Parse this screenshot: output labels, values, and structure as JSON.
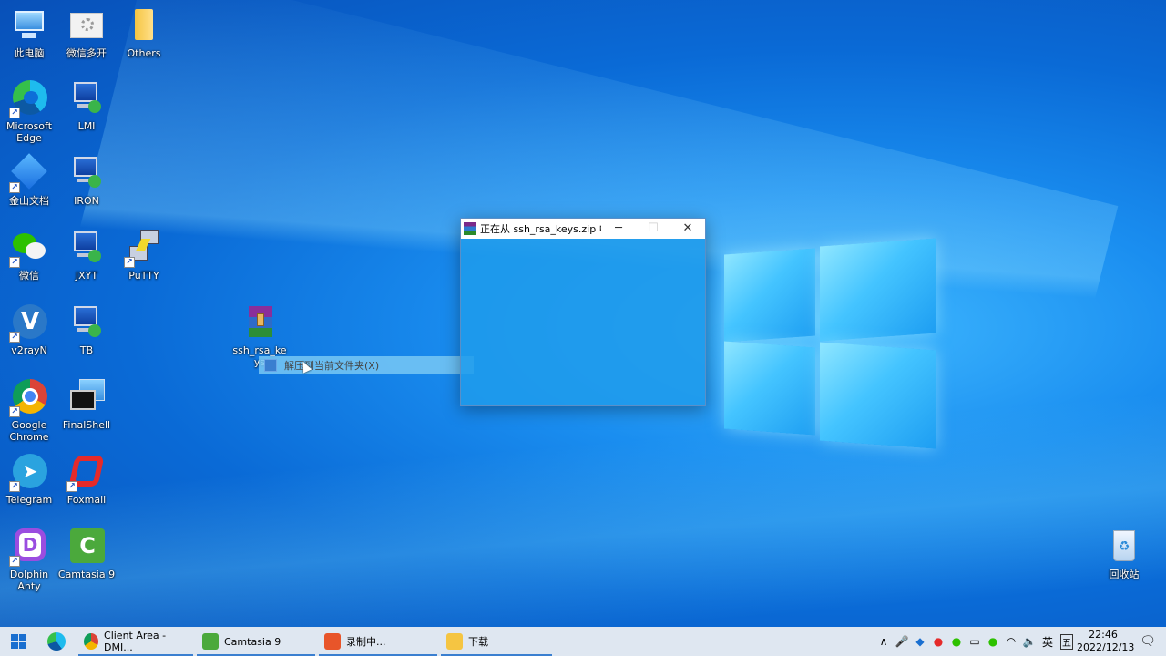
{
  "desktop": {
    "icons": [
      {
        "label": "此电脑"
      },
      {
        "label": "微信多开"
      },
      {
        "label": "Others"
      },
      {
        "label": "Microsoft Edge"
      },
      {
        "label": "LMI"
      },
      {
        "label": "金山文档"
      },
      {
        "label": "IRON"
      },
      {
        "label": "微信"
      },
      {
        "label": "JXYT"
      },
      {
        "label": "PuTTY"
      },
      {
        "label": "v2rayN"
      },
      {
        "label": "TB"
      },
      {
        "label": "ssh_rsa_keys"
      },
      {
        "label": "Google Chrome"
      },
      {
        "label": "FinalShell"
      },
      {
        "label": "Telegram"
      },
      {
        "label": "Foxmail"
      },
      {
        "label": "Dolphin Anty"
      },
      {
        "label": "Camtasia 9"
      },
      {
        "label": "回收站"
      }
    ],
    "context_menu_item": "解压到当前文件夹(X)"
  },
  "dialog": {
    "title": "正在从 ssh_rsa_keys.zip 中...",
    "minimize": "─",
    "maximize": "☐",
    "close": "✕"
  },
  "taskbar": {
    "apps": [
      {
        "label": "Client Area - DMI..."
      },
      {
        "label": "Camtasia 9"
      },
      {
        "label": "录制中..."
      },
      {
        "label": "下载"
      }
    ],
    "tray": {
      "chevron": "∧",
      "ime": "英",
      "ime2": "五",
      "time": "22:46",
      "date": "2022/12/13"
    }
  },
  "colors": {
    "accent": "#3a7fd0",
    "taskbar_bg": "#dfe7f1"
  }
}
